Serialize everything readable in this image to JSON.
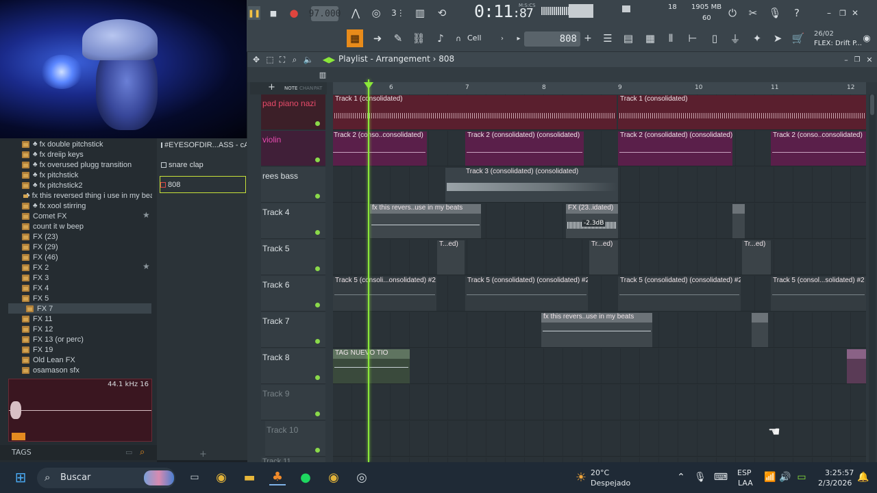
{
  "transport": {
    "tempo": "97.000",
    "time": "0:11",
    "time_frac": ":87",
    "time_units": "M:S:CS",
    "cpu_top": "18",
    "memory": "1905 MB",
    "polyphony": "60",
    "snap": "Cell",
    "pattern": "808",
    "hint_date": "26/02",
    "hint_text": "FLEX: Drift P..."
  },
  "playlist": {
    "title": "Playlist - Arrangement",
    "pattern": "808",
    "tabs": [
      "NOTE",
      "CHAN",
      "PAT"
    ],
    "bars": [
      "6",
      "7",
      "8",
      "9",
      "10",
      "11",
      "12"
    ],
    "tracks": [
      {
        "name": "pad piano nazi"
      },
      {
        "name": "violin"
      },
      {
        "name": "rees bass"
      },
      {
        "name": "Track 4"
      },
      {
        "name": "Track 5"
      },
      {
        "name": "Track 6"
      },
      {
        "name": "Track 7"
      },
      {
        "name": "Track 8"
      },
      {
        "name": "Track 9"
      },
      {
        "name": "Track 10"
      },
      {
        "name": "Track 11"
      }
    ],
    "clips": {
      "t1a": "Track 1 (consolidated)",
      "t1b": "Track 1 (consolidated)",
      "t2a": "Track 2 (conso..consolidated)",
      "t2b": "Track 2 (consolidated) (consolidated)",
      "t2c": "Track 2 (consolidated) (consolidated)",
      "t2d": "Track 2 (conso..consolidated)",
      "t3a": "Track 3 (consolidated) (consolidated)",
      "t4a": "fx this revers..use in my beats",
      "t4b": "FX (23..idated)",
      "t4b_gain": "-2.3dB",
      "t5a": "T...ed)",
      "t5b": "Tr...ed)",
      "t5c": "Tr...ed)",
      "t6a": "Track 5 (consoli...onsolidated) #2",
      "t6b": "Track 5 (consolidated) (consolidated) #2",
      "t6c": "Track 5 (consolidated) (consolidated) #2",
      "t6d": "Track 5 (consol...solidated) #2",
      "t7a": "fx this revers..use in my beats",
      "t8a": "TAG NUEVO TIO"
    }
  },
  "browser": {
    "items": [
      {
        "label": "fx double pitchstick",
        "club": true
      },
      {
        "label": "fx dreiip keys",
        "club": true
      },
      {
        "label": "fx overused plugg transition",
        "club": true
      },
      {
        "label": "fx pitchstick",
        "club": true
      },
      {
        "label": "fx pitchstick2",
        "club": true
      },
      {
        "label": "fx this reversed thing i use in my beats",
        "club": true
      },
      {
        "label": "fx xool stirring",
        "club": true
      },
      {
        "label": "Comet FX",
        "club": false
      },
      {
        "label": "count it w beep",
        "club": false
      },
      {
        "label": "FX (23)",
        "club": false
      },
      {
        "label": "FX (29)",
        "club": false
      },
      {
        "label": "FX (46)",
        "club": false
      },
      {
        "label": "FX 2",
        "club": false
      },
      {
        "label": "FX 3",
        "club": false
      },
      {
        "label": "FX 4",
        "club": false
      },
      {
        "label": "FX 5",
        "club": false
      },
      {
        "label": "FX 7",
        "club": false
      },
      {
        "label": "FX 11",
        "club": false
      },
      {
        "label": "FX 12",
        "club": false
      },
      {
        "label": "FX 13 (or perc)",
        "club": false
      },
      {
        "label": "FX 19",
        "club": false
      },
      {
        "label": "Old Lean FX",
        "club": false
      },
      {
        "label": "osamason sfx",
        "club": false
      }
    ],
    "preview_rate": "44.1 kHz 16",
    "tags_label": "TAGS"
  },
  "picker": {
    "items": [
      "#EYESOFDIR...ASS - cASH",
      "snare clap",
      "808"
    ]
  },
  "taskbar": {
    "search_placeholder": "Buscar",
    "weather_temp": "20°C",
    "weather_text": "Despejado",
    "lang_top": "ESP",
    "lang_bottom": "LAA",
    "clock_time": "3:25:57",
    "clock_date": "2/3/2026"
  },
  "colors": {
    "accent_green": "#8be83a",
    "clip_red": "#6b2434",
    "clip_magenta": "#6a2455",
    "clip_gray": "#5d676d"
  }
}
